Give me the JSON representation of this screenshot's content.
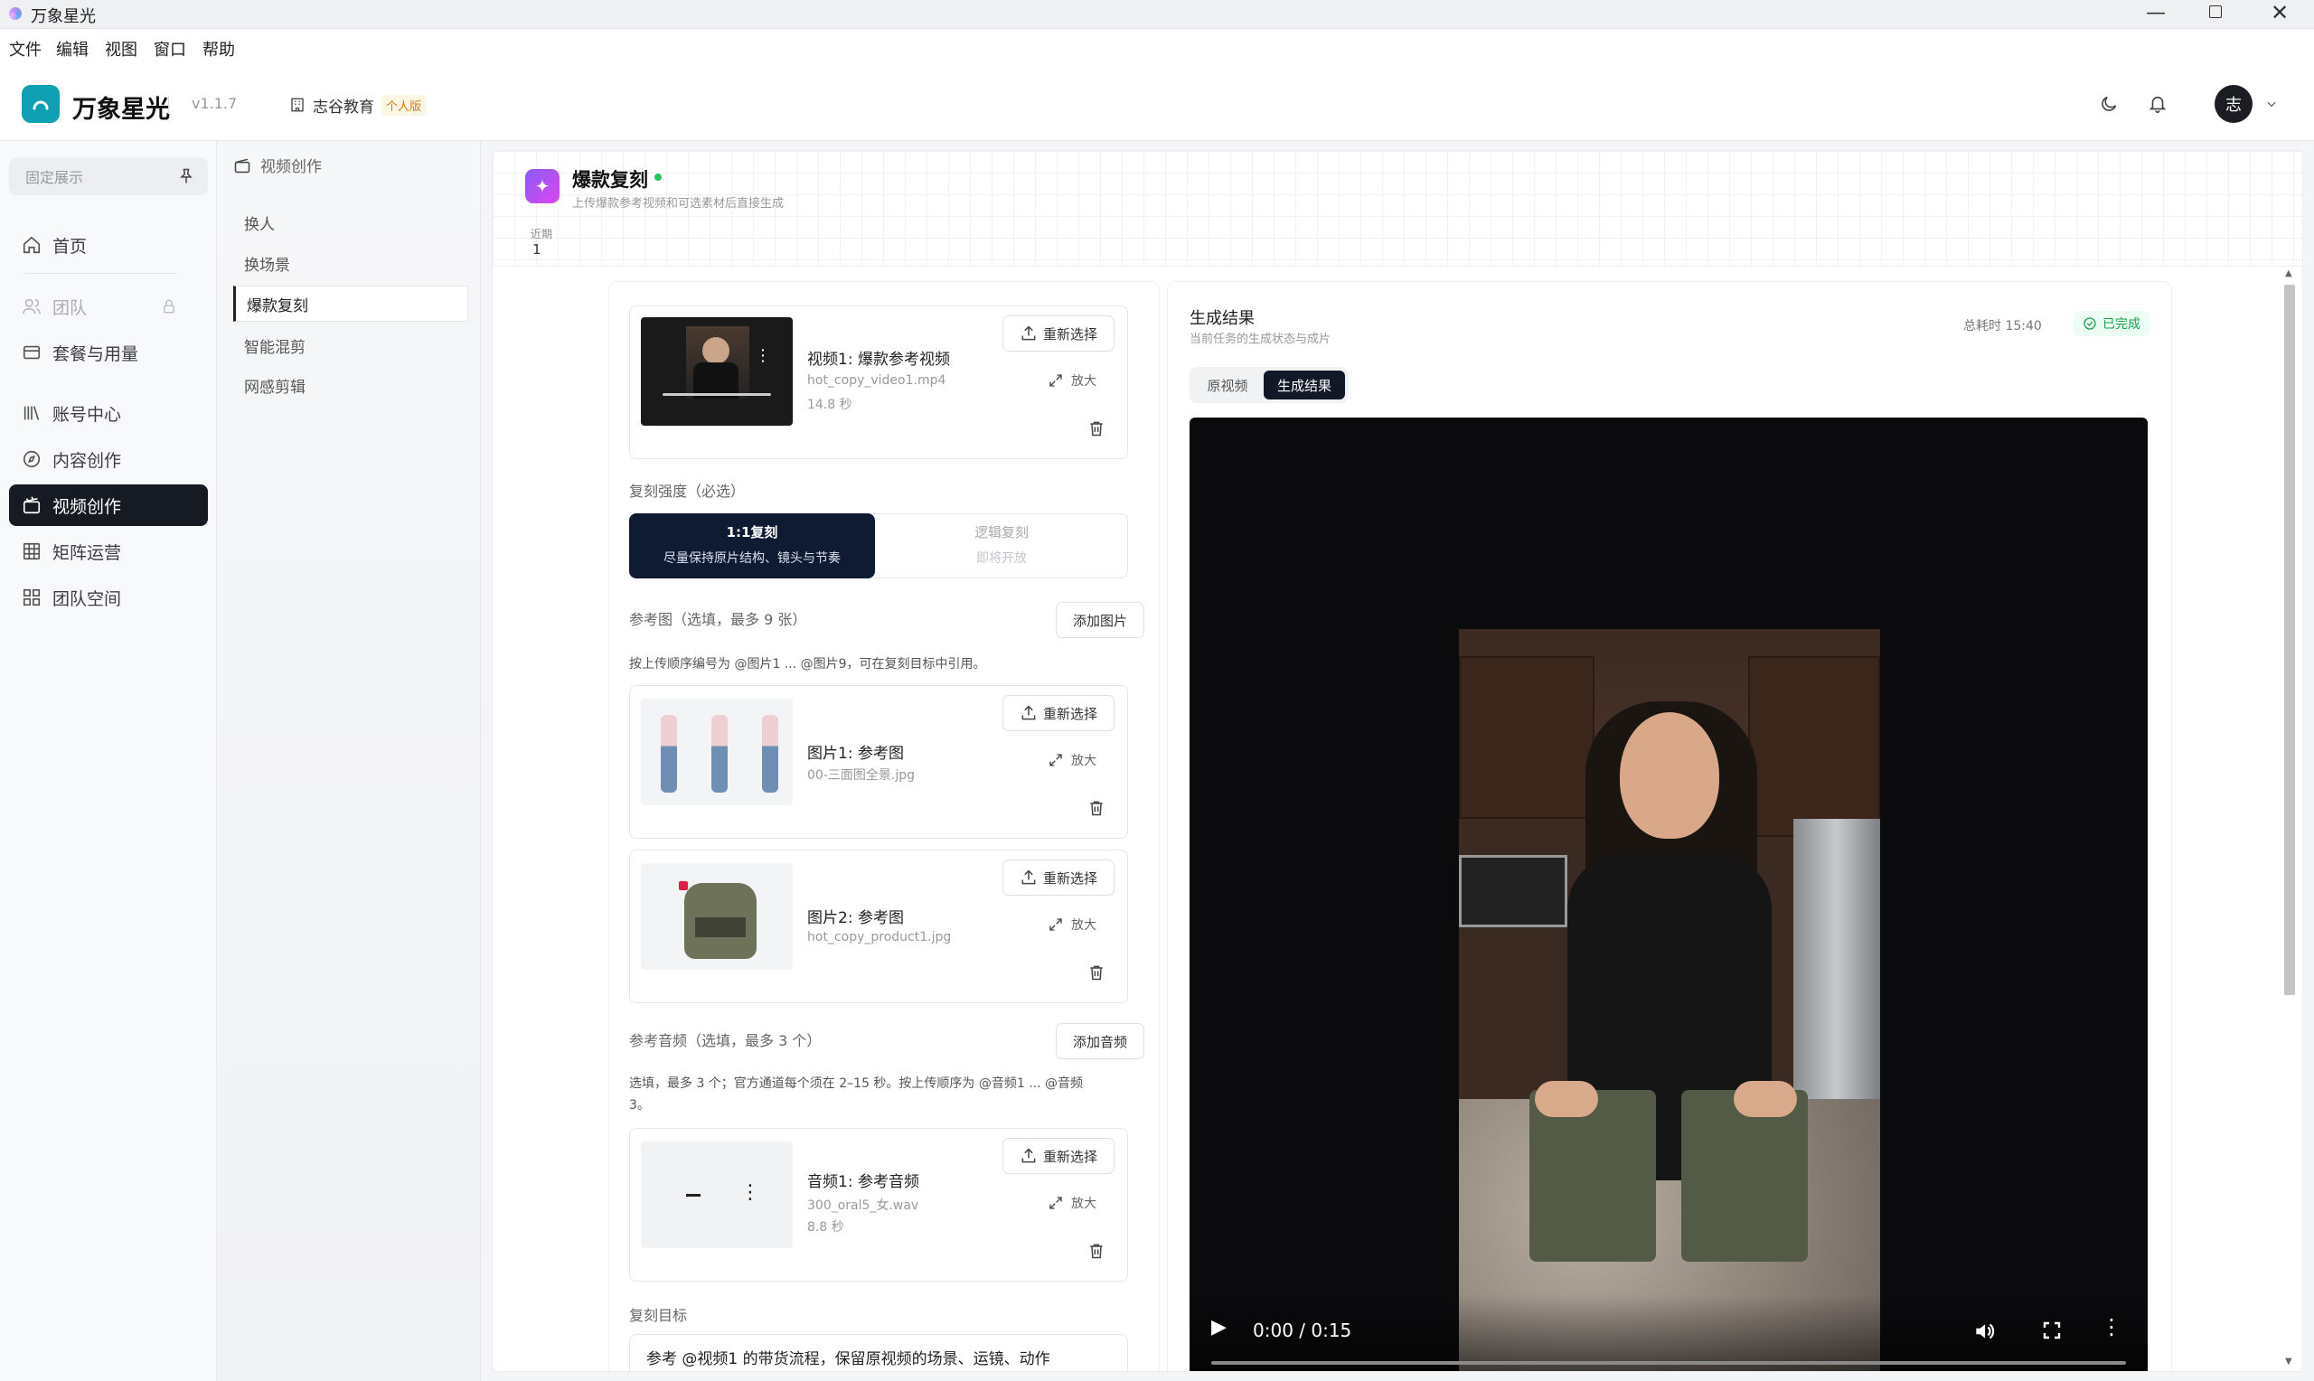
{
  "window": {
    "title": "万象星光"
  },
  "menu": [
    "文件",
    "编辑",
    "视图",
    "窗口",
    "帮助"
  ],
  "header": {
    "app_name": "万象星光",
    "version": "v1.1.7",
    "org": "志谷教育",
    "plan_badge": "个人版",
    "avatar_text": "志"
  },
  "sidebar": {
    "pinned_label": "固定展示",
    "items": [
      {
        "label": "首页",
        "icon": "home-icon"
      },
      {
        "label": "团队",
        "icon": "users-icon"
      },
      {
        "label": "套餐与用量",
        "icon": "card-icon"
      },
      {
        "label": "账号中心",
        "icon": "library-icon"
      },
      {
        "label": "内容创作",
        "icon": "compass-icon"
      },
      {
        "label": "视频创作",
        "icon": "clapperboard-icon"
      },
      {
        "label": "矩阵运营",
        "icon": "table-icon"
      },
      {
        "label": "团队空间",
        "icon": "grid-icon"
      }
    ]
  },
  "subnav": {
    "title": "视频创作",
    "items": [
      "换人",
      "换场景",
      "爆款复刻",
      "智能混剪",
      "网感剪辑"
    ]
  },
  "page": {
    "title": "爆款复刻",
    "subtitle": "上传爆款参考视频和可选素材后直接生成",
    "recent_label": "近期",
    "recent_value": "1"
  },
  "form": {
    "reselect_label": "重新选择",
    "zoom_label": "放大",
    "video": {
      "title": "视频1: 爆款参考视频",
      "file": "hot_copy_video1.mp4",
      "duration": "14.8 秒"
    },
    "strength": {
      "label": "复刻强度（必选）",
      "options": [
        {
          "title": "1:1复刻",
          "desc": "尽量保持原片结构、镜头与节奏"
        },
        {
          "title": "逻辑复刻",
          "desc": "即将开放"
        }
      ]
    },
    "ref_images": {
      "label": "参考图（选填，最多 9 张）",
      "add_label": "添加图片",
      "hint": "按上传顺序编号为 @图片1 ... @图片9，可在复刻目标中引用。",
      "items": [
        {
          "title": "图片1: 参考图",
          "file": "00-三面图全景.jpg"
        },
        {
          "title": "图片2: 参考图",
          "file": "hot_copy_product1.jpg"
        }
      ]
    },
    "ref_audio": {
      "label": "参考音频（选填，最多 3 个）",
      "add_label": "添加音频",
      "hint_line1": "选填，最多 3 个；官方通道每个须在 2–15 秒。按上传顺序为 @音频1 ... @音频",
      "hint_line2": "3。",
      "items": [
        {
          "title": "音频1: 参考音频",
          "file": "300_oral5_女.wav",
          "duration": "8.8 秒"
        }
      ]
    },
    "goal": {
      "label": "复刻目标",
      "text": "参考 @视频1 的带货流程，保留原视频的场景、运镜、动作"
    }
  },
  "result": {
    "title": "生成结果",
    "subtitle": "当前任务的生成状态与成片",
    "elapsed": "总耗时 15:40",
    "status": "已完成",
    "status_color": "#16a34a",
    "tabs": [
      "原视频",
      "生成结果"
    ],
    "player_time": "0:00 / 0:15"
  }
}
